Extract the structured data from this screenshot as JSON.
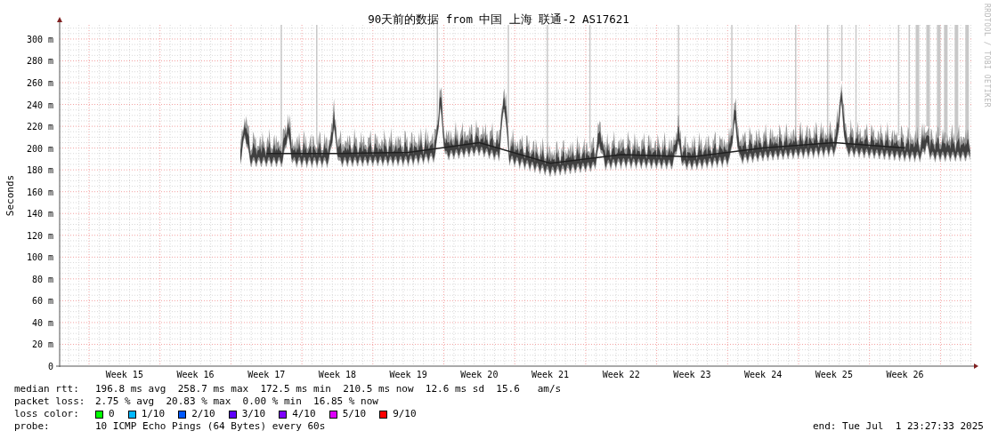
{
  "graph": {
    "credit": "RRDTOOL / TOBI OETIKER",
    "chart_data": {
      "type": "line",
      "title": "90天前的数据 from 中国 上海 联通-2 AS17621",
      "ylabel": "Seconds",
      "grid": true,
      "categories": [
        "Week 15",
        "Week 16",
        "Week 17",
        "Week 18",
        "Week 19",
        "Week 20",
        "Week 21",
        "Week 22",
        "Week 23",
        "Week 24",
        "Week 25",
        "Week 26"
      ],
      "series": [
        {
          "color": "#202020",
          "values": [
            null,
            null,
            195,
            195,
            196,
            205,
            186,
            194,
            192,
            200,
            205,
            200
          ]
        }
      ],
      "ylim": [
        0,
        313
      ],
      "yticks": [
        {
          "value": 0,
          "label": "0"
        },
        {
          "value": 20,
          "label": "20 m"
        },
        {
          "value": 40,
          "label": "40 m"
        },
        {
          "value": 60,
          "label": "60 m"
        },
        {
          "value": 80,
          "label": "80 m"
        },
        {
          "value": 100,
          "label": "100 m"
        },
        {
          "value": 120,
          "label": "120 m"
        },
        {
          "value": 140,
          "label": "140 m"
        },
        {
          "value": 160,
          "label": "160 m"
        },
        {
          "value": 180,
          "label": "180 m"
        },
        {
          "value": 200,
          "label": "200 m"
        },
        {
          "value": 220,
          "label": "220 m"
        },
        {
          "value": 240,
          "label": "240 m"
        },
        {
          "value": 260,
          "label": "260 m"
        },
        {
          "value": 280,
          "label": "280 m"
        },
        {
          "value": 300,
          "label": "300 m"
        }
      ]
    }
  },
  "stats": [
    {
      "label": "median rtt:",
      "value": "196.8 ms avg  258.7 ms max  172.5 ms min  210.5 ms now  12.6 ms sd  15.6   am/s"
    },
    {
      "label": "packet loss:",
      "value": "2.75 % avg  20.83 % max  0.00 % min  16.85 % now"
    }
  ],
  "loss_color": {
    "label": "loss color:",
    "items": [
      {
        "label": "0",
        "color": "#00ff00"
      },
      {
        "label": "1/10",
        "color": "#00b8ff"
      },
      {
        "label": "2/10",
        "color": "#0059ff"
      },
      {
        "label": "3/10",
        "color": "#5e00ff"
      },
      {
        "label": "4/10",
        "color": "#7e00ff"
      },
      {
        "label": "5/10",
        "color": "#dd00ff"
      },
      {
        "label": "9/10",
        "color": "#ff0000"
      }
    ]
  },
  "probe": {
    "label": "probe:",
    "value": "10 ICMP Echo Pings (64 Bytes) every 60s"
  },
  "end": "end: Tue Jul  1 23:27:33 2025"
}
